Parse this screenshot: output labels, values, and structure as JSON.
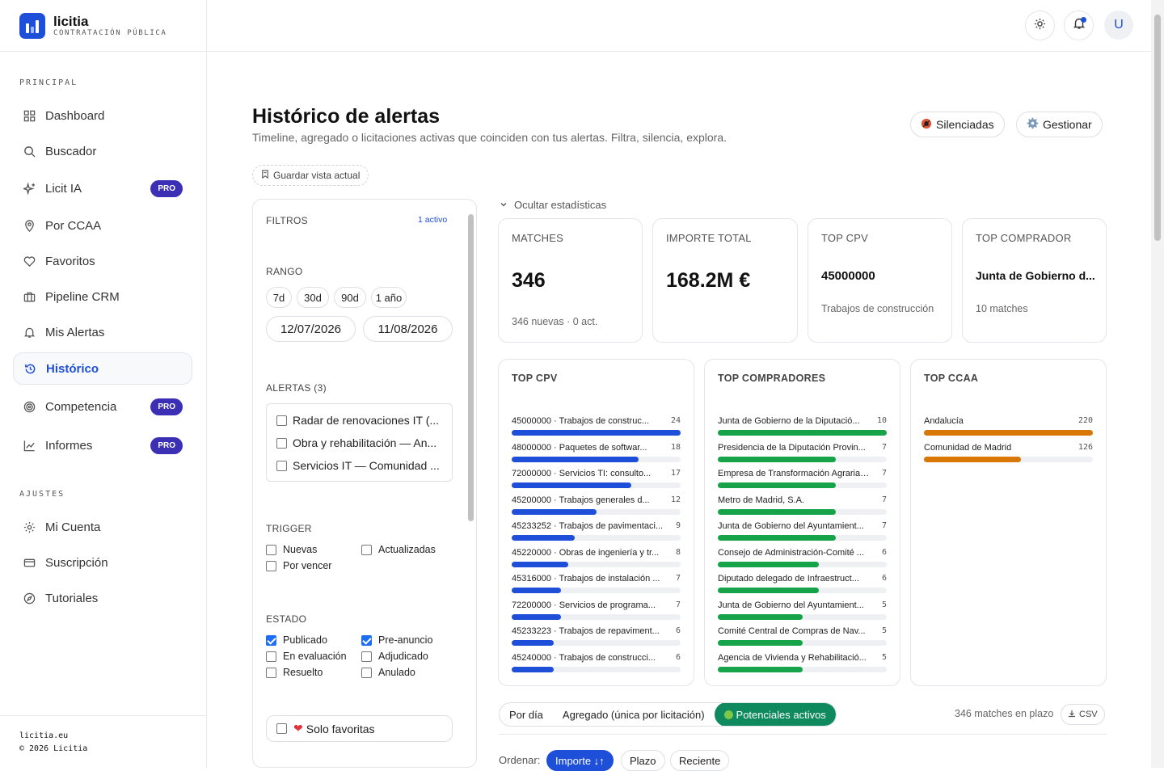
{
  "app": {
    "name": "licitia",
    "tagline": "CONTRATACIÓN PÚBLICA"
  },
  "sidebar": {
    "section_principal": "PRINCIPAL",
    "section_ajustes": "AJUSTES",
    "items": [
      {
        "label": "Dashboard",
        "icon": "grid-icon"
      },
      {
        "label": "Buscador",
        "icon": "search-icon"
      },
      {
        "label": "Licit IA",
        "icon": "sparkles-icon",
        "badge": "PRO"
      },
      {
        "label": "Por CCAA",
        "icon": "map-pin-icon"
      },
      {
        "label": "Favoritos",
        "icon": "heart-icon"
      },
      {
        "label": "Pipeline CRM",
        "icon": "briefcase-icon"
      },
      {
        "label": "Mis Alertas",
        "icon": "bell-icon"
      },
      {
        "label": "Histórico",
        "icon": "history-icon"
      },
      {
        "label": "Competencia",
        "icon": "target-icon",
        "badge": "PRO"
      },
      {
        "label": "Informes",
        "icon": "chart-icon",
        "badge": "PRO"
      }
    ],
    "settings": [
      {
        "label": "Mi Cuenta",
        "icon": "gear-icon"
      },
      {
        "label": "Suscripción",
        "icon": "card-icon"
      },
      {
        "label": "Tutoriales",
        "icon": "compass-icon"
      }
    ],
    "footer": {
      "site": "licitia.eu",
      "copyright": "© 2026 Licitia"
    }
  },
  "topbar": {
    "avatar": "U"
  },
  "page": {
    "title": "Histórico de alertas",
    "subtitle": "Timeline, agregado o licitaciones activas que coinciden con tus alertas. Filtra, silencia, explora.",
    "silenced": "Silenciadas",
    "manage": "Gestionar",
    "save_view": "Guardar vista actual"
  },
  "filters": {
    "title": "FILTROS",
    "active": "1 activo",
    "range_title": "RANGO",
    "range_chips": [
      "7d",
      "30d",
      "90d",
      "1 año"
    ],
    "date_from": "12/07/2026",
    "date_to": "11/08/2026",
    "alerts_title": "ALERTAS (3)",
    "alerts": [
      "Radar de renovaciones IT (...",
      "Obra y rehabilitación — An...",
      "Servicios IT — Comunidad ..."
    ],
    "trigger_title": "TRIGGER",
    "trigger": {
      "nuevas": "Nuevas",
      "actualizadas": "Actualizadas",
      "por_vencer": "Por vencer"
    },
    "estado_title": "ESTADO",
    "estado": {
      "publicado": "Publicado",
      "pre_anuncio": "Pre-anuncio",
      "en_evaluacion": "En evaluación",
      "adjudicado": "Adjudicado",
      "resuelto": "Resuelto",
      "anulado": "Anulado"
    },
    "favorites": "Solo favoritas"
  },
  "stats": {
    "toggle": "Ocultar estadísticas",
    "matches": {
      "label": "MATCHES",
      "value": "346",
      "detail": "346 nuevas · 0 act."
    },
    "importe": {
      "label": "IMPORTE TOTAL",
      "value": "168.2M €"
    },
    "top_cpv": {
      "label": "TOP CPV",
      "value": "45000000",
      "detail": "Trabajos de construcción"
    },
    "top_comprador": {
      "label": "TOP COMPRADOR",
      "value": "Junta de Gobierno d...",
      "detail": "10 matches"
    }
  },
  "panels": {
    "cpv": {
      "title": "TOP CPV",
      "color": "#1f4fd8",
      "max": 24,
      "rows": [
        {
          "label": "45000000 · Trabajos de construc...",
          "value": 24
        },
        {
          "label": "48000000 · Paquetes de softwar...",
          "value": 18
        },
        {
          "label": "72000000 · Servicios TI: consulto...",
          "value": 17
        },
        {
          "label": "45200000 · Trabajos generales d...",
          "value": 12
        },
        {
          "label": "45233252 · Trabajos de pavimentaci...",
          "value": 9
        },
        {
          "label": "45220000 · Obras de ingeniería y tr...",
          "value": 8
        },
        {
          "label": "45316000 · Trabajos de instalación ...",
          "value": 7
        },
        {
          "label": "72200000 · Servicios de programa...",
          "value": 7
        },
        {
          "label": "45233223 · Trabajos de repaviment...",
          "value": 6
        },
        {
          "label": "45240000 · Trabajos de construcci...",
          "value": 6
        }
      ]
    },
    "buyers": {
      "title": "TOP COMPRADORES",
      "color": "#16a34a",
      "max": 10,
      "rows": [
        {
          "label": "Junta de Gobierno de la Diputació...",
          "value": 10
        },
        {
          "label": "Presidencia de la Diputación Provin...",
          "value": 7
        },
        {
          "label": "Empresa de Transformación Agraria ...",
          "value": 7
        },
        {
          "label": "Metro de Madrid, S.A.",
          "value": 7
        },
        {
          "label": "Junta de Gobierno del Ayuntamient...",
          "value": 7
        },
        {
          "label": "Consejo de Administración-Comité ...",
          "value": 6
        },
        {
          "label": "Diputado delegado de Infraestruct...",
          "value": 6
        },
        {
          "label": "Junta de Gobierno del Ayuntamient...",
          "value": 5
        },
        {
          "label": "Comité Central de Compras de Nav...",
          "value": 5
        },
        {
          "label": "Agencia de Vivienda y Rehabilitació...",
          "value": 5
        }
      ]
    },
    "ccaa": {
      "title": "TOP CCAA",
      "color": "#d97706",
      "max": 220,
      "rows": [
        {
          "label": "Andalucía",
          "value": 220
        },
        {
          "label": "Comunidad de Madrid",
          "value": 126
        }
      ]
    }
  },
  "views": {
    "tabs": [
      "Por día",
      "Agregado (única por licitación)",
      "Potenciales activos"
    ],
    "active": 2,
    "summary": "346 matches en plazo",
    "csv": "CSV"
  },
  "sort": {
    "label": "Ordenar:",
    "options": [
      "Importe ↓↑",
      "Plazo",
      "Reciente"
    ]
  }
}
